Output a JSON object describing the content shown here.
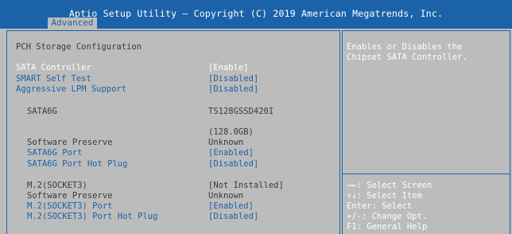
{
  "header": {
    "title": "Aptio Setup Utility – Copyright (C) 2019 American Megatrends, Inc.",
    "tab": "Advanced"
  },
  "page": {
    "heading": "PCH Storage Configuration"
  },
  "items": {
    "sata_controller": {
      "label": "SATA Controller",
      "value": "[Enable]"
    },
    "smart_self_test": {
      "label": "SMART Self Test",
      "value": "[Disabled]"
    },
    "aggressive_lpm": {
      "label": "Aggressive LPM Support",
      "value": "[Disabled]"
    },
    "sata6g": {
      "label": "SATA6G",
      "value": "TS128GSSD420I",
      "capacity": "(128.0GB)"
    },
    "sata6g_preserve": {
      "label": "Software Preserve",
      "value": "Unknown"
    },
    "sata6g_port": {
      "label": "SATA6G Port",
      "value": "[Enabled]"
    },
    "sata6g_hotplug": {
      "label": "SATA6G Port Hot Plug",
      "value": "[Disabled]"
    },
    "m2": {
      "label": "M.2(SOCKET3)",
      "value": "[Not Installed]"
    },
    "m2_preserve": {
      "label": "Software Preserve",
      "value": "Unknown"
    },
    "m2_port": {
      "label": "M.2(SOCKET3) Port",
      "value": "[Enabled]"
    },
    "m2_hotplug": {
      "label": "M.2(SOCKET3) Port Hot Plug",
      "value": "[Disabled]"
    }
  },
  "help": {
    "line1": "Enables or Disables the",
    "line2": "Chipset SATA Controller."
  },
  "keys": {
    "select_screen": "→←: Select Screen",
    "select_item": "↑↓: Select Item",
    "enter": "Enter: Select",
    "change": "+/-: Change Opt.",
    "general_help": "F1: General Help"
  }
}
